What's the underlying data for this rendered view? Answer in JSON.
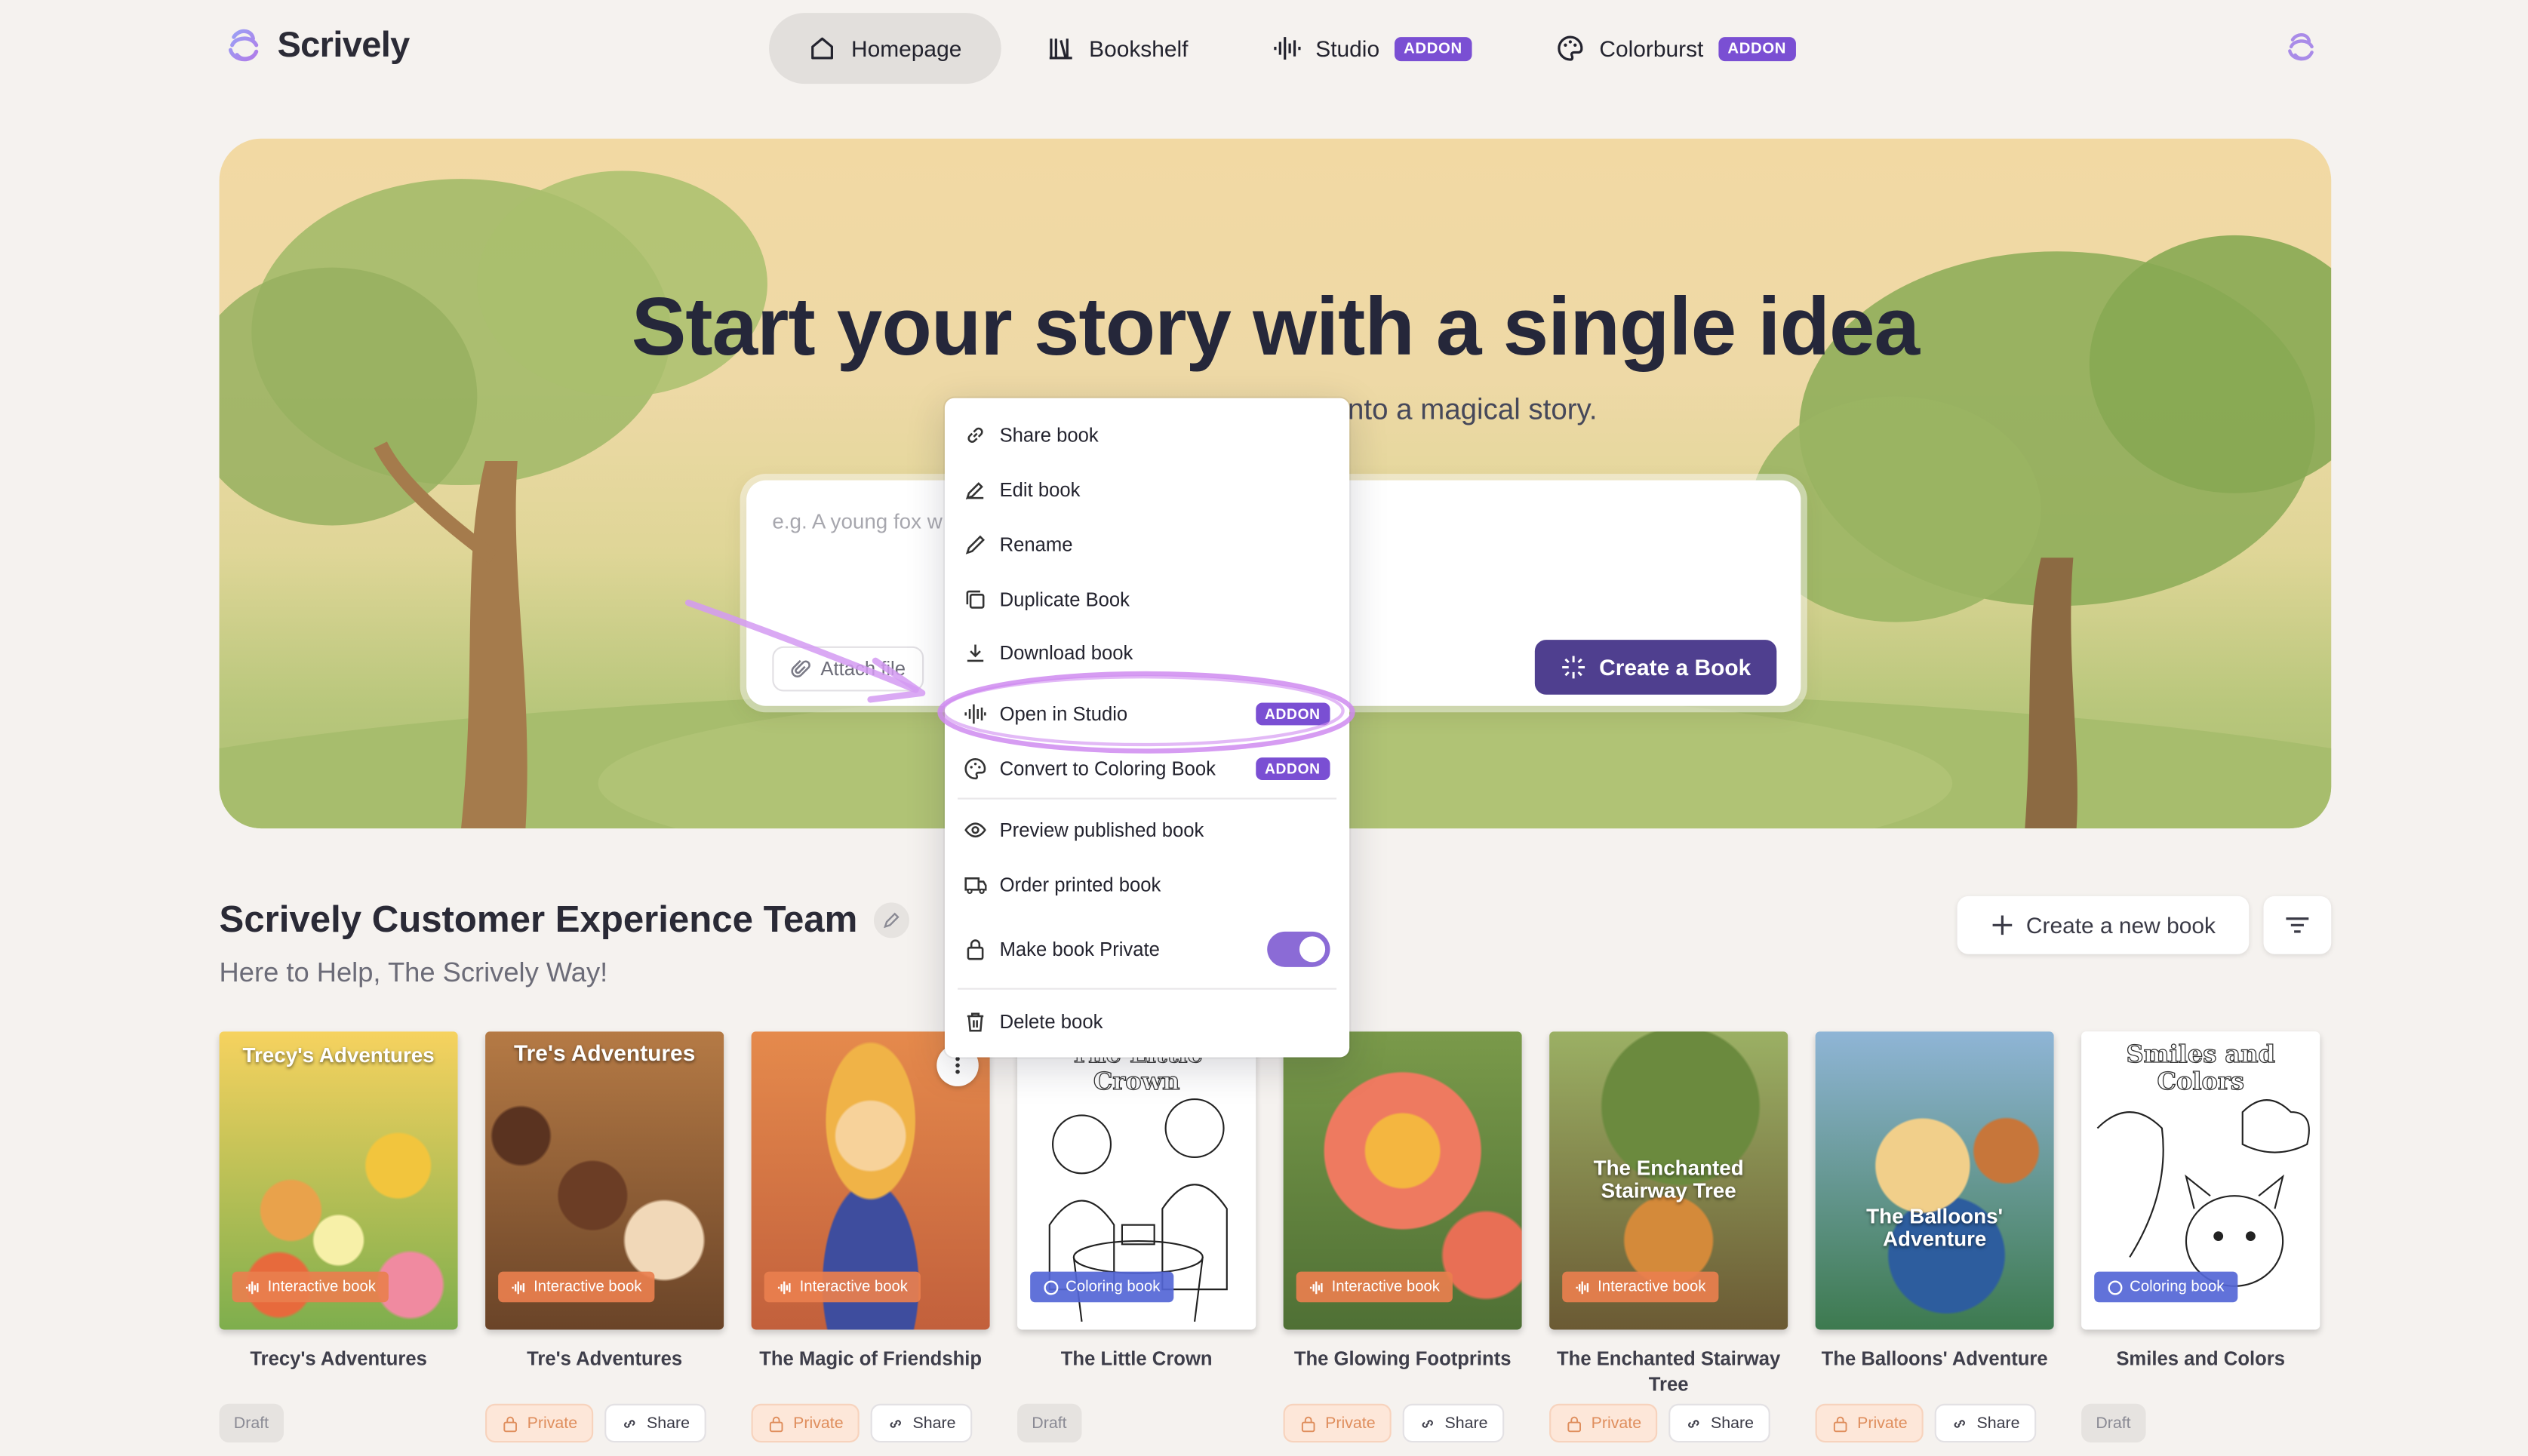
{
  "app": {
    "name": "Scrively"
  },
  "nav": {
    "items": [
      {
        "label": "Homepage",
        "active": true
      },
      {
        "label": "Bookshelf"
      },
      {
        "label": "Studio",
        "badge": "ADDON"
      },
      {
        "label": "Colorburst",
        "badge": "ADDON"
      }
    ]
  },
  "hero": {
    "title": "Start your story with a single idea",
    "subtitle_visible": "nto a magical story.",
    "placeholder": "e.g. A young fox w",
    "attach_label": "Attach file",
    "create_label": "Create a Book"
  },
  "menu": {
    "items": [
      {
        "label": "Share book",
        "icon": "link-icon"
      },
      {
        "label": "Edit book",
        "icon": "edit-book-icon"
      },
      {
        "label": "Rename",
        "icon": "pencil-icon"
      },
      {
        "label": "Duplicate Book",
        "icon": "duplicate-icon"
      },
      {
        "label": "Download book",
        "icon": "download-icon"
      },
      {
        "label": "Open in Studio",
        "icon": "audio-wave-icon",
        "badge": "ADDON"
      },
      {
        "label": "Convert to Coloring Book",
        "icon": "palette-icon",
        "badge": "ADDON"
      },
      {
        "label": "Preview published book",
        "icon": "eye-icon"
      },
      {
        "label": "Order printed book",
        "icon": "truck-icon"
      },
      {
        "label": "Make book Private",
        "icon": "lock-icon",
        "toggle_on": true
      },
      {
        "label": "Delete book",
        "icon": "trash-icon"
      }
    ]
  },
  "section": {
    "title": "Scrively Customer Experience Team",
    "subtitle": "Here to Help, The Scrively Way!",
    "new_book_label": "Create a new book"
  },
  "books": [
    {
      "name": "Trecy's Adventures",
      "cover_title": "Trecy's Adventures",
      "kind": "Interactive book",
      "status": "Draft"
    },
    {
      "name": "Tre's Adventures",
      "cover_title": "Tre's Adventures",
      "kind": "Interactive book",
      "status": "Private",
      "share": "Share"
    },
    {
      "name": "The Magic of Friendship",
      "cover_title": "",
      "kind": "Interactive book",
      "status": "Private",
      "share": "Share"
    },
    {
      "name": "The Little Crown",
      "cover_title": "The Little Crown",
      "kind": "Coloring book",
      "status": "Draft"
    },
    {
      "name": "The Glowing Footprints",
      "cover_title": "",
      "kind": "Interactive book",
      "status": "Private",
      "share": "Share"
    },
    {
      "name": "The Enchanted Stairway Tree",
      "cover_title": "The Enchanted Stairway Tree",
      "kind": "Interactive book",
      "status": "Private",
      "share": "Share"
    },
    {
      "name": "The Balloons' Adventure",
      "cover_title": "The Balloons' Adventure",
      "kind": "",
      "status": "Private",
      "share": "Share"
    },
    {
      "name": "Smiles and Colors",
      "cover_title": "Smiles and Colors",
      "kind": "Coloring book",
      "status": "Draft"
    }
  ],
  "colors": {
    "accent": "#7a4fd3",
    "primary_button": "#4f3f8f",
    "private_chip": "#df8e5d",
    "annotation": "#cf8bf0"
  }
}
